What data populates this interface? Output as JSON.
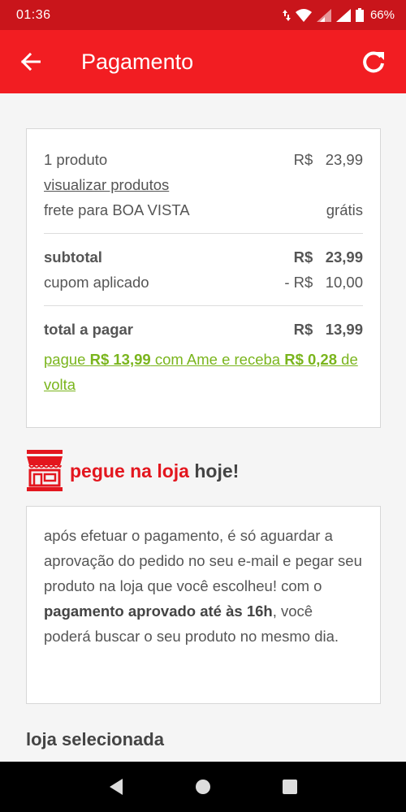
{
  "status_bar": {
    "time": "01:36",
    "battery": "66%"
  },
  "app_bar": {
    "title": "Pagamento"
  },
  "summary": {
    "products_label": "1 produto",
    "products_value": "R$   23,99",
    "view_products_link": "visualizar produtos",
    "shipping_label": "frete para BOA VISTA",
    "shipping_value": "grátis",
    "subtotal_label": "subtotal",
    "subtotal_value": "R$   23,99",
    "coupon_label": "cupom aplicado",
    "coupon_value": "- R$   10,00",
    "total_label": "total a pagar",
    "total_value": "R$   13,99",
    "promo": {
      "part1": "pague ",
      "amount": "R$ 13,99",
      "part2": " com Ame e receba ",
      "cashback": "R$ 0,28",
      "part3": " de volta"
    }
  },
  "pickup": {
    "title_red": "pegue na loja",
    "title_rest": " hoje!",
    "text_part1": "após efetuar o pagamento, é só aguardar a aprovação do pedido no seu e-mail e pegar seu produto na loja que você escolheu! com o ",
    "text_bold": "pagamento aprovado até às 16h",
    "text_part2": ", você poderá buscar o seu produto no mesmo dia."
  },
  "selected_store_title": "loja selecionada",
  "colors": {
    "status_bar": "#c9151b",
    "app_bar": "#f21d22",
    "accent_green": "#7ab51d",
    "accent_red": "#e3161e"
  }
}
